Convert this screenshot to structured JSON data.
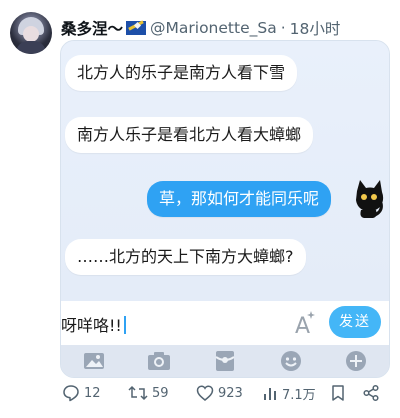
{
  "tweet": {
    "display_name": "桑多涅〜",
    "handle": "@Marionette_Sa",
    "separator": "·",
    "time": "18小时"
  },
  "chat": {
    "messages": [
      {
        "side": "left",
        "text": "北方人的乐子是南方人看下雪"
      },
      {
        "side": "left",
        "text": "南方人乐子是看北方人看大蟑螂"
      },
      {
        "side": "right",
        "text": "草，那如何才能同乐呢"
      },
      {
        "side": "left",
        "text": "……北方的天上下南方大蟑螂?"
      }
    ],
    "input_text": "呀咩咯!!",
    "send_label": "发送"
  },
  "actions": {
    "replies": "12",
    "retweets": "59",
    "likes": "923",
    "views": "7.1万"
  },
  "colors": {
    "accent": "#2fa2f3",
    "send": "#44b6f7",
    "chat_bg": "#e7effa",
    "muted": "#536471"
  }
}
